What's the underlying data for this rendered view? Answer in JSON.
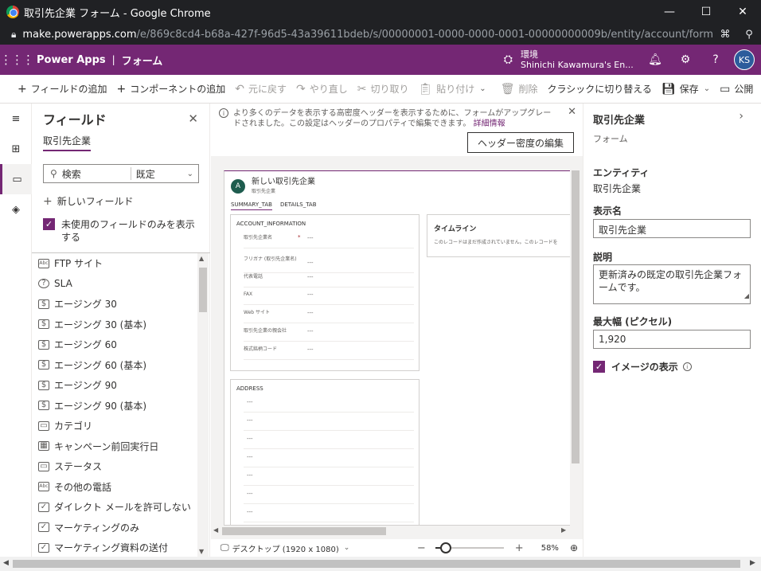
{
  "window": {
    "title": "取引先企業 フォーム - Google Chrome",
    "url_domain": "make.powerapps.com",
    "url_path": "/e/869c8cd4-b68a-427f-96d5-43a39611bdeb/s/00000001-0000-0000-0001-00000000009b/entity/account/form/..."
  },
  "appbar": {
    "app_name": "Power Apps",
    "separator": "|",
    "section": "フォーム",
    "env_label": "環境",
    "env_name": "Shinichi Kawamura's En...",
    "avatar": "KS"
  },
  "commands": {
    "add_field": "フィールドの追加",
    "add_component": "コンポーネントの追加",
    "undo": "元に戻す",
    "redo": "やり直し",
    "cut": "切り取り",
    "paste": "貼り付け",
    "delete": "削除",
    "classic": "クラシックに切り替える",
    "save": "保存",
    "publish": "公開"
  },
  "fields_panel": {
    "title": "フィールド",
    "tab": "取引先企業",
    "search_placeholder": "検索",
    "filter": "既定",
    "new_field": "新しいフィールド",
    "unused_only": "未使用のフィールドのみを表示する",
    "items": [
      {
        "icon": "Abc",
        "label": "FTP サイト"
      },
      {
        "icon": "?",
        "label": "SLA"
      },
      {
        "icon": "$",
        "label": "エージング 30"
      },
      {
        "icon": "$",
        "label": "エージング 30 (基本)"
      },
      {
        "icon": "$",
        "label": "エージング 60"
      },
      {
        "icon": "$",
        "label": "エージング 60 (基本)"
      },
      {
        "icon": "$",
        "label": "エージング 90"
      },
      {
        "icon": "$",
        "label": "エージング 90 (基本)"
      },
      {
        "icon": "▭",
        "label": "カテゴリ"
      },
      {
        "icon": "▦",
        "label": "キャンペーン前回実行日"
      },
      {
        "icon": "▭",
        "label": "ステータス"
      },
      {
        "icon": "Abc",
        "label": "その他の電話"
      },
      {
        "icon": "✓",
        "label": "ダイレクト メールを許可しない"
      },
      {
        "icon": "✓",
        "label": "マーケティングのみ"
      },
      {
        "icon": "✓",
        "label": "マーケティング資料の送付"
      }
    ]
  },
  "canvas": {
    "banner_text": "より多くのデータを表示する高密度ヘッダーを表示するために、フォームがアップグレードされました。この設定はヘッダーのプロパティで編集できます。",
    "banner_link": "詳細情報",
    "header_button": "ヘッダー密度の編集",
    "form_title": "新しい取引先企業",
    "form_subtitle": "取引先企業",
    "form_icon": "A",
    "tabs": [
      "SUMMARY_TAB",
      "DETAILS_TAB"
    ],
    "account_section": "ACCOUNT_INFORMATION",
    "account_fields": [
      {
        "label": "取引先企業名",
        "value": "---"
      },
      {
        "label": "フリガナ (取引先企業名)",
        "value": "---"
      },
      {
        "label": "代表電話",
        "value": "---"
      },
      {
        "label": "FAX",
        "value": "---"
      },
      {
        "label": "Web サイト",
        "value": "---"
      },
      {
        "label": "取引先企業の親会社",
        "value": "---"
      },
      {
        "label": "株式銘柄コード",
        "value": "---"
      }
    ],
    "required_mark": "*",
    "timeline_title": "タイムライン",
    "timeline_text": "このレコードはまだ作成されていません。このレコードを",
    "address_section": "ADDRESS",
    "address_values": [
      "---",
      "---",
      "---",
      "---",
      "---",
      "---",
      "---"
    ],
    "device": "デスクトップ (1920 x 1080)",
    "zoom": "58%",
    "zoom_fraction": 0.15
  },
  "props_panel": {
    "title": "取引先企業",
    "subtitle": "フォーム",
    "entity_label": "エンティティ",
    "entity_value": "取引先企業",
    "display_name_label": "表示名",
    "display_name_value": "取引先企業",
    "description_label": "説明",
    "description_value": "更新済みの既定の取引先企業フォームです。",
    "max_width_label": "最大幅 (ピクセル)",
    "max_width_value": "1,920",
    "show_image_label": "イメージの表示"
  },
  "colors": {
    "brand": "#742774",
    "chrome_dark": "#202124"
  }
}
